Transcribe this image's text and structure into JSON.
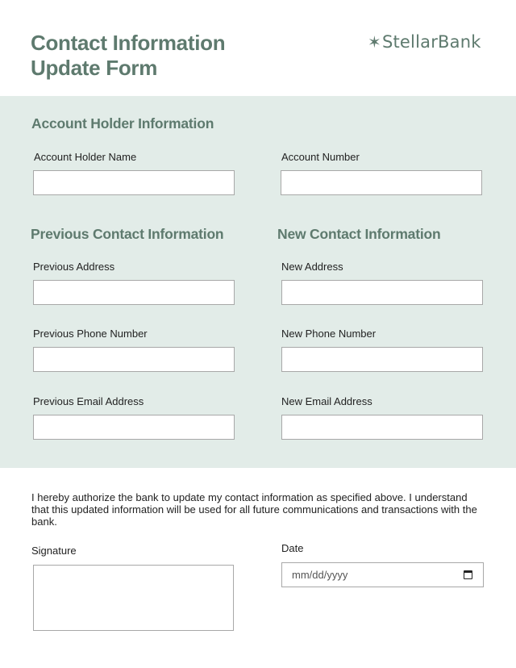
{
  "header": {
    "title_line1": "Contact Information",
    "title_line2": "Update Form",
    "logo_symbol": "✶",
    "logo_text": "StellarBank"
  },
  "colors": {
    "accent": "#5e7a6e",
    "panel_bg": "#e2ece8",
    "field_border": "#a8a8a8"
  },
  "account_holder": {
    "heading": "Account Holder Information",
    "name_label": "Account Holder Name",
    "name_value": "",
    "number_label": "Account Number",
    "number_value": ""
  },
  "previous_contact": {
    "heading": "Previous Contact Information",
    "address_label": "Previous Address",
    "phone_label": "Previous Phone Number",
    "email_label": "Previous Email Address"
  },
  "new_contact": {
    "heading": "New Contact Information",
    "address_label": "New Address",
    "phone_label": "New Phone Number",
    "email_label": "New Email Address"
  },
  "authorization": {
    "text": "I hereby authorize the bank to update my contact information as specified above. I understand that this updated information will be used for all future communications and transactions with the bank.",
    "signature_label": "Signature",
    "date_label": "Date",
    "date_placeholder": "mm/dd/yyyy",
    "date_icon": "calendar-icon"
  }
}
